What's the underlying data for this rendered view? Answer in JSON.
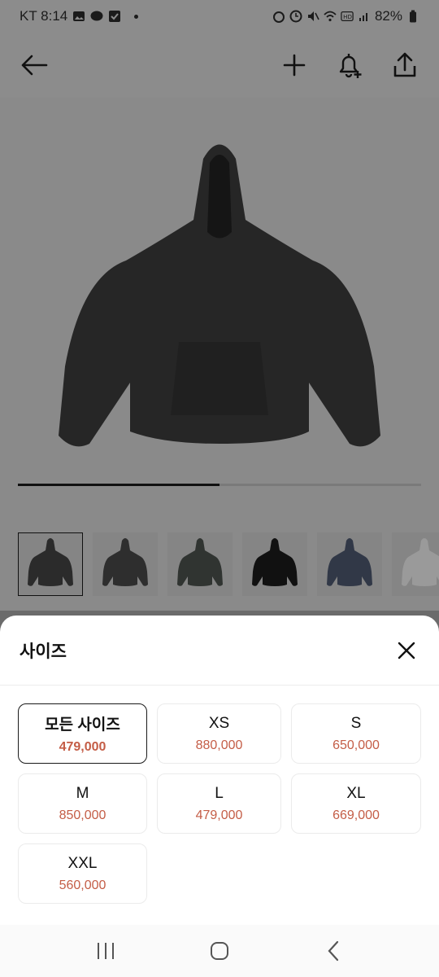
{
  "status_bar": {
    "carrier_time": "KT 8:14",
    "battery": "82%"
  },
  "top_bar": {
    "icons": [
      "back-arrow-icon",
      "plus-icon",
      "bell-plus-icon",
      "share-icon"
    ]
  },
  "gallery": {
    "progress_fraction": 0.5,
    "thumbnail_count": 6,
    "thumbnail_colors": [
      "#2b2b2b",
      "#2e2e2e",
      "#303431",
      "#111111",
      "#313847",
      "#9a9a9a"
    ],
    "selected_thumbnail": 0
  },
  "size_sheet": {
    "title": "사이즈",
    "options": [
      {
        "size": "모든 사이즈",
        "price": "479,000",
        "selected": true
      },
      {
        "size": "XS",
        "price": "880,000",
        "selected": false
      },
      {
        "size": "S",
        "price": "650,000",
        "selected": false
      },
      {
        "size": "M",
        "price": "850,000",
        "selected": false
      },
      {
        "size": "L",
        "price": "479,000",
        "selected": false
      },
      {
        "size": "XL",
        "price": "669,000",
        "selected": false
      },
      {
        "size": "XXL",
        "price": "560,000",
        "selected": false
      }
    ]
  },
  "colors": {
    "price": "#c45d46",
    "overlay": "#8a8a8a"
  }
}
